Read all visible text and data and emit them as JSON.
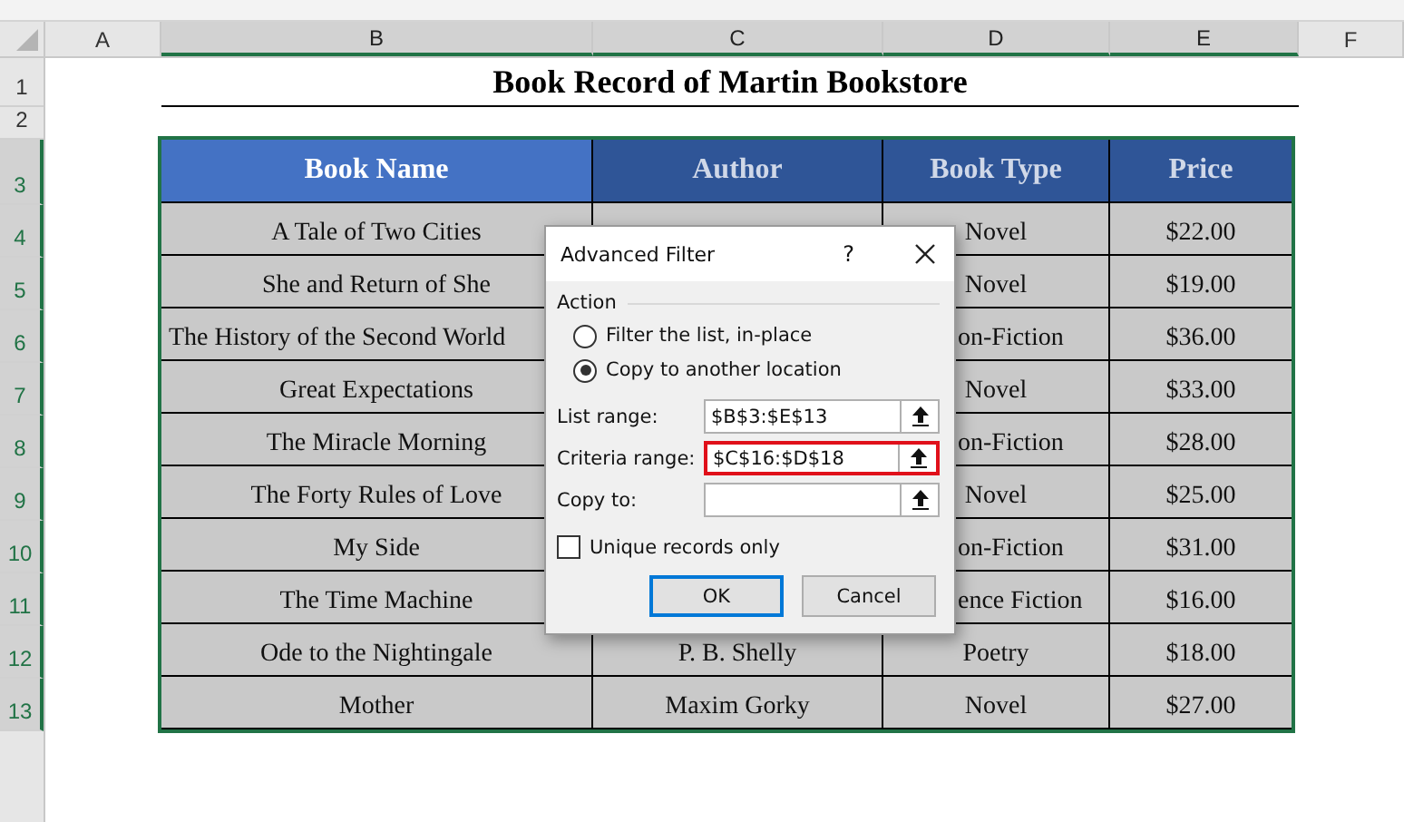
{
  "sheet": {
    "column_headers": [
      {
        "label": "A",
        "selected": false
      },
      {
        "label": "B",
        "selected": true
      },
      {
        "label": "C",
        "selected": true
      },
      {
        "label": "D",
        "selected": true
      },
      {
        "label": "E",
        "selected": true
      },
      {
        "label": "F",
        "selected": false
      }
    ],
    "row_headers": [
      {
        "label": "1",
        "selected": false
      },
      {
        "label": "2",
        "selected": false
      },
      {
        "label": "3",
        "selected": true
      },
      {
        "label": "4",
        "selected": true
      },
      {
        "label": "5",
        "selected": true
      },
      {
        "label": "6",
        "selected": true
      },
      {
        "label": "7",
        "selected": true
      },
      {
        "label": "8",
        "selected": true
      },
      {
        "label": "9",
        "selected": true
      },
      {
        "label": "10",
        "selected": true
      },
      {
        "label": "11",
        "selected": true
      },
      {
        "label": "12",
        "selected": true
      },
      {
        "label": "13",
        "selected": true
      }
    ],
    "title": "Book Record of Martin Bookstore",
    "table": {
      "columns": [
        {
          "label": "Book Name",
          "active": true
        },
        {
          "label": "Author",
          "active": false
        },
        {
          "label": "Book Type",
          "active": false
        },
        {
          "label": "Price",
          "active": false
        }
      ],
      "rows": [
        {
          "book_name": "A Tale of Two Cities",
          "book_type": "Novel",
          "type_clipped": false,
          "price": "$22.00"
        },
        {
          "book_name": "She and Return of She",
          "book_type": "Novel",
          "type_clipped": false,
          "price": "$19.00"
        },
        {
          "book_name": "The History of the Second World",
          "name_clipped": true,
          "book_type": "on-Fiction",
          "type_clipped": true,
          "price": "$36.00"
        },
        {
          "book_name": "Great Expectations",
          "book_type": "Novel",
          "type_clipped": false,
          "price": "$33.00"
        },
        {
          "book_name": "The Miracle Morning",
          "book_type": "on-Fiction",
          "type_clipped": true,
          "price": "$28.00"
        },
        {
          "book_name": "The Forty Rules of Love",
          "book_type": "Novel",
          "type_clipped": false,
          "price": "$25.00"
        },
        {
          "book_name": "My Side",
          "book_type": "on-Fiction",
          "type_clipped": true,
          "price": "$31.00"
        },
        {
          "book_name": "The Time Machine",
          "book_type": "ence Fiction",
          "type_clipped": true,
          "price": "$16.00"
        },
        {
          "book_name": "Ode to the Nightingale",
          "author": "P. B. Shelly",
          "book_type": "Poetry",
          "type_clipped": false,
          "price": "$18.00"
        },
        {
          "book_name": "Mother",
          "author": "Maxim Gorky",
          "book_type": "Novel",
          "type_clipped": false,
          "price": "$27.00"
        }
      ]
    }
  },
  "dialog": {
    "title": "Advanced Filter",
    "help": "?",
    "group_label": "Action",
    "radios": [
      {
        "label": "Filter the list, in-place",
        "selected": false
      },
      {
        "label": "Copy to another location",
        "selected": true
      }
    ],
    "fields": [
      {
        "label": "List range:",
        "value": "$B$3:$E$13",
        "highlighted": false
      },
      {
        "label": "Criteria range:",
        "value": "$C$16:$D$18",
        "highlighted": true
      },
      {
        "label": "Copy to:",
        "highlighted": false
      }
    ],
    "checkbox": {
      "label": "Unique records only",
      "checked": false
    },
    "buttons": [
      {
        "label": "OK",
        "default": true
      },
      {
        "label": "Cancel",
        "default": false
      }
    ]
  }
}
